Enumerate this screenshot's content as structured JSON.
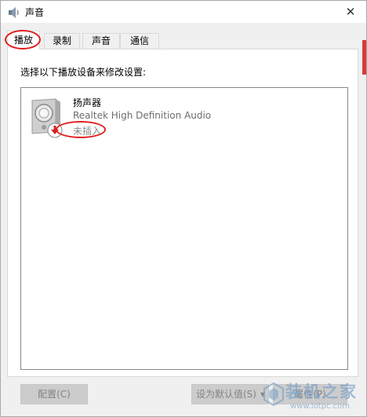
{
  "window": {
    "title": "声音",
    "close_glyph": "✕",
    "icon": "speaker-icon"
  },
  "tabs": [
    {
      "label": "播放",
      "active": true
    },
    {
      "label": "录制",
      "active": false
    },
    {
      "label": "声音",
      "active": false
    },
    {
      "label": "通信",
      "active": false
    }
  ],
  "panel": {
    "instruction": "选择以下播放设备来修改设置:"
  },
  "devices": [
    {
      "name": "扬声器",
      "driver": "Realtek High Definition Audio",
      "status": "未插入",
      "icon": "speaker-unplugged-icon"
    }
  ],
  "buttons": {
    "configure": "配置(C)",
    "set_default": "设为默认值(S)",
    "set_default_arrow": "▾",
    "properties": "属性(P)"
  },
  "watermark": {
    "text": "装机之家",
    "url": "www.lotpc.com"
  },
  "colors": {
    "annotation": "#e01d1d",
    "unplugged_arrow": "#d32020",
    "disabled_button": "#cccccc",
    "watermark": "#7ea3c9"
  }
}
